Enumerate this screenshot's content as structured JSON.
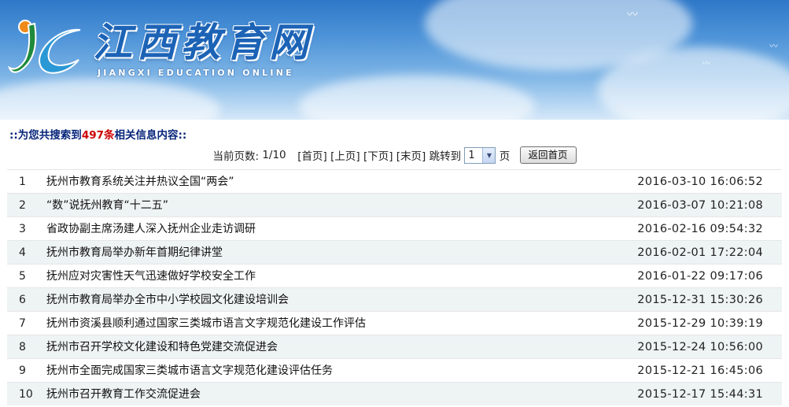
{
  "banner": {
    "title": "江西教育网",
    "subtitle": "JIANGXI EDUCATION ONLINE",
    "logo_icon": "jx-swirl-logo-icon"
  },
  "summary": {
    "prefix": "::为您共搜索到",
    "count": "497条",
    "suffix": "相关信息内容::"
  },
  "pager": {
    "current_label": "当前页数:",
    "current_value": "1/10",
    "first": "[首页]",
    "prev": "[上页]",
    "next": "[下页]",
    "last": "[末页]",
    "jump_label": "跳转到",
    "page_select_value": "1",
    "page_unit": "页",
    "home_button": "返回首页"
  },
  "articles": [
    {
      "index": "1",
      "title": "抚州市教育系统关注并热议全国“两会”",
      "date": "2016-03-10 16:06:52"
    },
    {
      "index": "2",
      "title": "“数”说抚州教育“十二五”",
      "date": "2016-03-07 10:21:08"
    },
    {
      "index": "3",
      "title": "省政协副主席汤建人深入抚州企业走访调研",
      "date": "2016-02-16 09:54:32"
    },
    {
      "index": "4",
      "title": "抚州市教育局举办新年首期纪律讲堂",
      "date": "2016-02-01 17:22:04"
    },
    {
      "index": "5",
      "title": "抚州应对灾害性天气迅速做好学校安全工作",
      "date": "2016-01-22 09:17:06"
    },
    {
      "index": "6",
      "title": "抚州市教育局举办全市中小学校园文化建设培训会",
      "date": "2015-12-31 15:30:26"
    },
    {
      "index": "7",
      "title": "抚州市资溪县顺利通过国家三类城市语言文字规范化建设工作评估",
      "date": "2015-12-29 10:39:19"
    },
    {
      "index": "8",
      "title": "抚州市召开学校文化建设和特色党建交流促进会",
      "date": "2015-12-24 10:56:00"
    },
    {
      "index": "9",
      "title": "抚州市全面完成国家三类城市语言文字规范化建设评估任务",
      "date": "2015-12-21 16:45:06"
    },
    {
      "index": "10",
      "title": "抚州市召开教育工作交流促进会",
      "date": "2015-12-17 15:44:31"
    }
  ],
  "colors": {
    "summary_text": "#06247a",
    "count_highlight": "#cc0000",
    "alt_row": "#eef3f4",
    "banner_sky": "#4d93d8"
  }
}
